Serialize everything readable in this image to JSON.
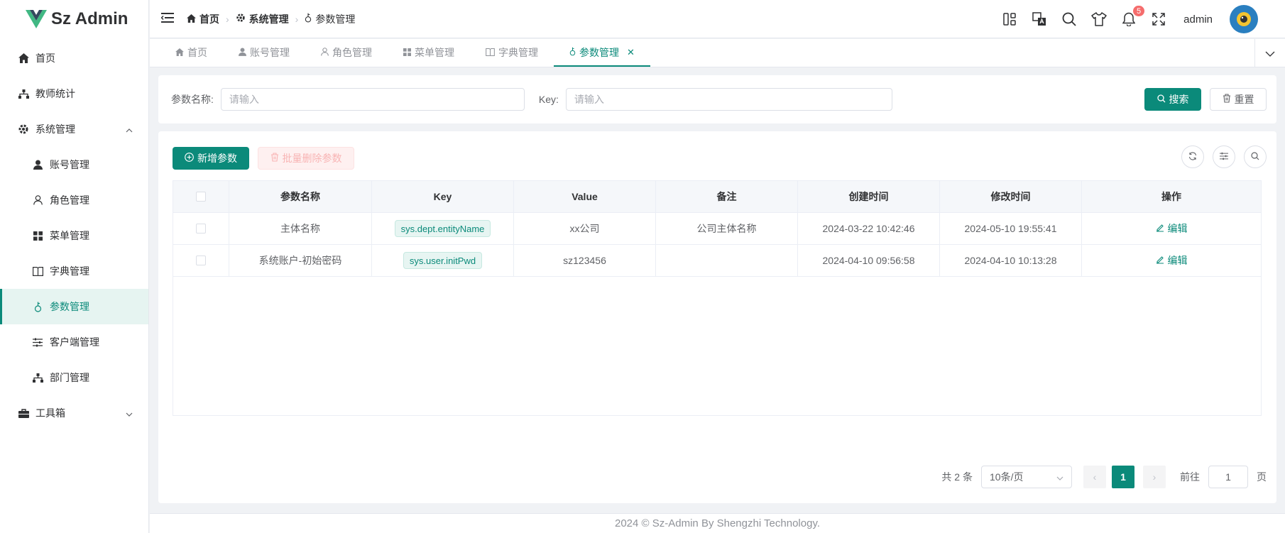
{
  "app": {
    "title": "Sz Admin"
  },
  "sidebar": {
    "items": [
      {
        "label": "首页"
      },
      {
        "label": "教师统计"
      },
      {
        "label": "系统管理"
      },
      {
        "label": "账号管理"
      },
      {
        "label": "角色管理"
      },
      {
        "label": "菜单管理"
      },
      {
        "label": "字典管理"
      },
      {
        "label": "参数管理"
      },
      {
        "label": "客户端管理"
      },
      {
        "label": "部门管理"
      },
      {
        "label": "工具箱"
      }
    ]
  },
  "header": {
    "breadcrumb": [
      "首页",
      "系统管理",
      "参数管理"
    ],
    "notification_count": "5",
    "username": "admin"
  },
  "tabs": [
    {
      "label": "首页"
    },
    {
      "label": "账号管理"
    },
    {
      "label": "角色管理"
    },
    {
      "label": "菜单管理"
    },
    {
      "label": "字典管理"
    },
    {
      "label": "参数管理",
      "active": true
    }
  ],
  "search": {
    "name_label": "参数名称:",
    "name_placeholder": "请输入",
    "key_label": "Key:",
    "key_placeholder": "请输入",
    "search_button": "搜索",
    "reset_button": "重置"
  },
  "toolbar": {
    "add_button": "新增参数",
    "batch_delete_button": "批量删除参数"
  },
  "table": {
    "columns": [
      "参数名称",
      "Key",
      "Value",
      "备注",
      "创建时间",
      "修改时间",
      "操作"
    ],
    "rows": [
      {
        "name": "主体名称",
        "key": "sys.dept.entityName",
        "value": "xx公司",
        "remark": "公司主体名称",
        "created": "2024-03-22 10:42:46",
        "modified": "2024-05-10 19:55:41",
        "action": "编辑"
      },
      {
        "name": "系统账户-初始密码",
        "key": "sys.user.initPwd",
        "value": "sz123456",
        "remark": "",
        "created": "2024-04-10 09:56:58",
        "modified": "2024-04-10 10:13:28",
        "action": "编辑"
      }
    ]
  },
  "pagination": {
    "total": "共 2 条",
    "page_size": "10条/页",
    "current_page": "1",
    "goto_label": "前往",
    "goto_value": "1",
    "page_suffix": "页"
  },
  "footer": {
    "text": "2024 © Sz-Admin By Shengzhi Technology."
  },
  "colors": {
    "primary": "#0b8a7a",
    "danger": "#f56c6c"
  }
}
